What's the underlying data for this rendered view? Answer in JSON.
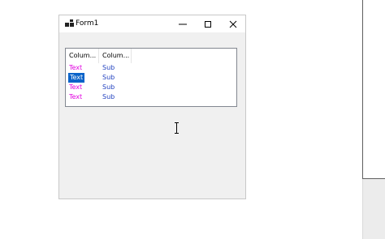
{
  "window": {
    "title": "Form1"
  },
  "listview": {
    "columns": [
      "Colum...",
      "Colum..."
    ],
    "rows": [
      {
        "col1": "Text",
        "col2": "Sub",
        "selected": false
      },
      {
        "col1": "Text",
        "col2": "Sub",
        "selected": true
      },
      {
        "col1": "Text",
        "col2": "Sub",
        "selected": false
      },
      {
        "col1": "Text",
        "col2": "Sub",
        "selected": false
      }
    ]
  },
  "colors": {
    "item_text": "#e000e0",
    "subitem_text": "#1f3fbf",
    "selection": "#0a63c9",
    "client_background": "#f0f0f0"
  },
  "icons": {
    "app": "app-icon",
    "minimize": "minimize-icon",
    "maximize": "maximize-icon",
    "close": "close-icon",
    "cursor": "text-cursor-icon"
  }
}
